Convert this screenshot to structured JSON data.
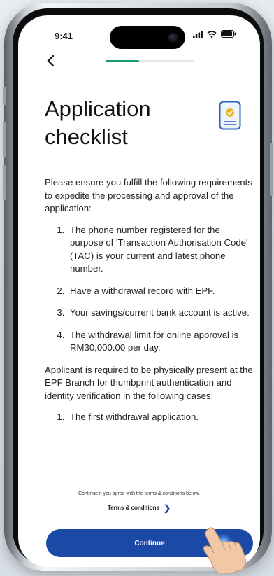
{
  "status_bar": {
    "time": "9:41"
  },
  "header": {
    "progress_fraction": 0.38
  },
  "page": {
    "title_line1": "Application",
    "title_line2": "checklist"
  },
  "intro": "Please ensure you fulfill the following requirements to expedite the processing and approval of the application:",
  "requirements": [
    "The phone number registered for the purpose of 'Transaction Authorisation Code' (TAC) is your current and latest phone number.",
    "Have a withdrawal record with EPF.",
    "Your savings/current bank account is active.",
    "The withdrawal limit for online approval is RM30,000.00 per day."
  ],
  "physical_note": "Applicant is required to be physically present at the EPF Branch for thumbprint authentication and identity verification in the following cases:",
  "cases": [
    "The first withdrawal application."
  ],
  "footer": {
    "consent": "Continue if you agree with the terms & conditions below.",
    "terms_label": "Terms & conditions",
    "continue_label": "Continue"
  },
  "colors": {
    "accent": "#1b4aa6",
    "progress": "#1b9b6b"
  }
}
